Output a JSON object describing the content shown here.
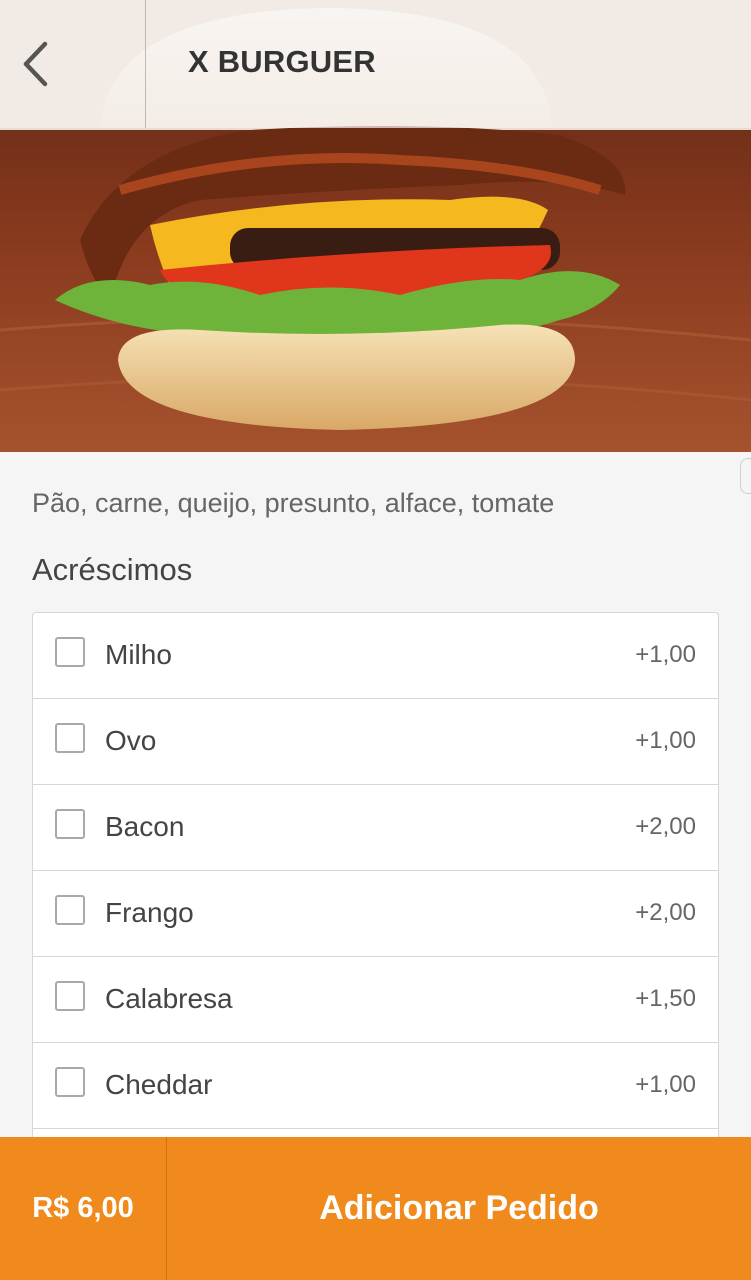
{
  "header": {
    "title": "X BURGUER",
    "back_icon": "chevron-left-icon"
  },
  "product": {
    "image": "burger-photo",
    "description": "Pão, carne, queijo, presunto, alface, tomate"
  },
  "extras": {
    "section_title": "Acréscimos",
    "items": [
      {
        "name": "Milho",
        "price": "+1,00",
        "checked": false
      },
      {
        "name": "Ovo",
        "price": "+1,00",
        "checked": false
      },
      {
        "name": "Bacon",
        "price": "+2,00",
        "checked": false
      },
      {
        "name": "Frango",
        "price": "+2,00",
        "checked": false
      },
      {
        "name": "Calabresa",
        "price": "+1,50",
        "checked": false
      },
      {
        "name": "Cheddar",
        "price": "+1,00",
        "checked": false
      }
    ]
  },
  "footer": {
    "total": "R$ 6,00",
    "add_label": "Adicionar Pedido"
  },
  "colors": {
    "accent": "#f08a1c",
    "background": "#f5f5f5"
  }
}
